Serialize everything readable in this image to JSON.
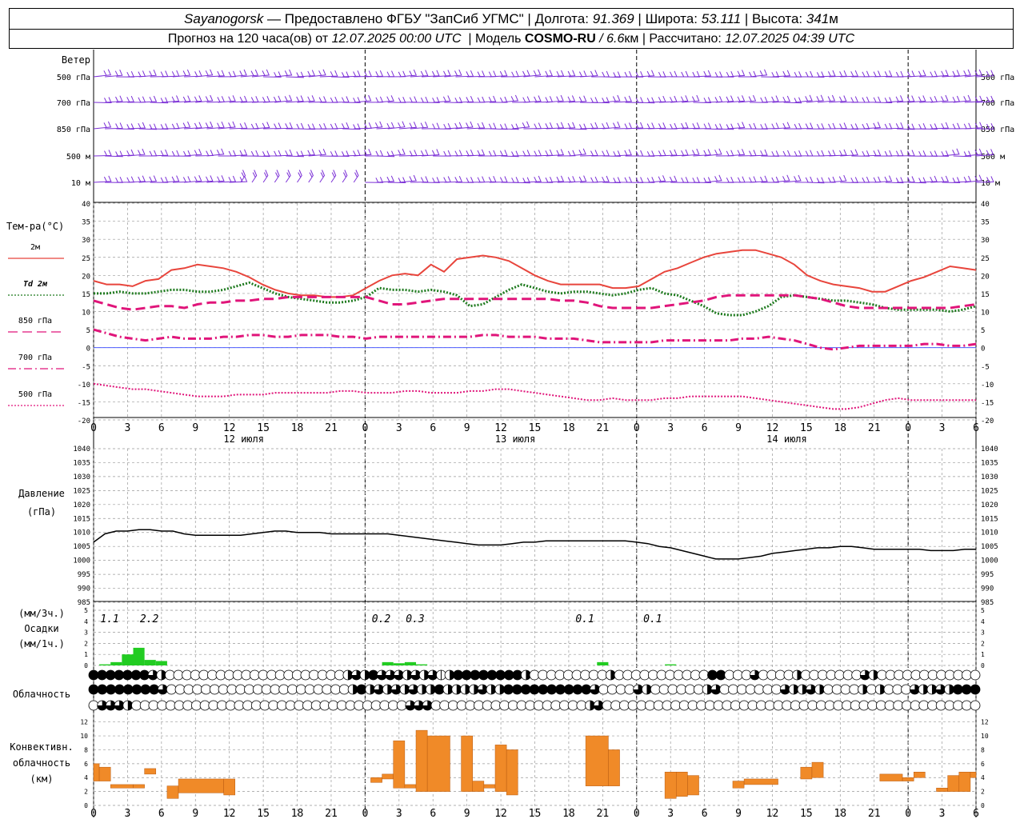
{
  "header": {
    "station": "Sayanogorsk",
    "provided_by": "— Предоставлено ФГБУ \"ЗапСиб УГМС\"",
    "lon_label": "Долгота:",
    "lon_value": "91.369",
    "lat_label": "Широта:",
    "lat_value": "53.111",
    "alt_label": "Высота:",
    "alt_value": "341",
    "alt_unit": "м",
    "forecast_prefix": "Прогноз на 120 часа(ов) от",
    "forecast_start": "12.07.2025 00:00 UTC",
    "model_label": "Модель",
    "model_name": "COSMO-RU",
    "model_res": "/ 6.6",
    "model_res_unit": "км",
    "calc_label": "Рассчитано:",
    "calc_time": "12.07.2025 04:39 UTC"
  },
  "chart_data": [
    {
      "type": "barbs",
      "title": "Ветер",
      "levels": [
        "500 гПа",
        "700 гПа",
        "850 гПа",
        "500 м",
        "10 м"
      ],
      "right_levels": [
        "500 гПа",
        "700 гПа",
        "850 гПа",
        "500 м",
        "10 м"
      ],
      "color": "#7b2fd6"
    },
    {
      "type": "line",
      "title": "Тем-ра(°С)",
      "ylim": [
        -20,
        40
      ],
      "yticks": [
        -20,
        -15,
        -10,
        -5,
        0,
        5,
        10,
        15,
        20,
        25,
        30,
        35,
        40
      ],
      "x_ticks": [
        "0",
        "3",
        "6",
        "9",
        "12",
        "15",
        "18",
        "21",
        "0",
        "3",
        "6",
        "9",
        "12",
        "15",
        "18",
        "21",
        "0",
        "3",
        "6",
        "9",
        "12",
        "15",
        "18",
        "21",
        "0",
        "3",
        "6"
      ],
      "day_labels": [
        "12 июля",
        "13 июля",
        "14 июля"
      ],
      "series": [
        {
          "name": "2м",
          "color": "#e8453c",
          "style": "solid",
          "values": [
            18.5,
            17.5,
            17.5,
            17.0,
            18.5,
            19.0,
            21.5,
            22.0,
            23.0,
            22.5,
            22.0,
            21.0,
            19.5,
            17.5,
            16.0,
            15.0,
            14.5,
            14.5,
            14.0,
            14.0,
            14.5,
            16.5,
            18.5,
            20.0,
            20.5,
            20.0,
            23.0,
            21.0,
            24.5,
            25.0,
            25.5,
            25.0,
            24.0,
            22.0,
            20.0,
            18.5,
            17.5,
            17.5,
            17.5,
            17.5,
            16.5,
            16.5,
            17.0,
            19.0,
            21.0,
            22.0,
            23.5,
            25.0,
            26.0,
            26.5,
            27.0,
            27.0,
            26.0,
            25.0,
            23.0,
            20.0,
            18.5,
            17.5,
            17.0,
            16.5,
            15.5,
            15.5,
            17.0,
            18.5,
            19.5,
            21.0,
            22.5,
            22.0,
            21.5
          ]
        },
        {
          "name": "Td 2м",
          "color": "#1e7a1e",
          "style": "dotted",
          "values": [
            15.0,
            15.0,
            15.5,
            15.0,
            15.0,
            15.5,
            16.0,
            16.0,
            15.5,
            15.5,
            16.0,
            17.0,
            18.0,
            16.5,
            15.0,
            14.0,
            13.5,
            13.0,
            12.5,
            12.5,
            13.0,
            14.0,
            16.5,
            16.0,
            16.0,
            15.5,
            16.0,
            15.5,
            14.5,
            11.5,
            12.0,
            14.0,
            16.0,
            17.5,
            16.5,
            15.5,
            15.0,
            15.5,
            15.5,
            15.0,
            14.5,
            15.0,
            16.0,
            16.5,
            15.0,
            14.5,
            13.0,
            11.5,
            9.5,
            9.0,
            9.0,
            10.0,
            11.5,
            14.0,
            14.5,
            14.0,
            13.5,
            13.0,
            13.0,
            12.5,
            12.0,
            11.0,
            10.5,
            10.5,
            10.5,
            10.5,
            10.0,
            10.5,
            11.5
          ]
        },
        {
          "name": "850 гПа",
          "color": "#e0157a",
          "style": "dashed",
          "values": [
            13.0,
            12.0,
            11.0,
            10.5,
            11.0,
            11.5,
            11.5,
            11.0,
            12.0,
            12.5,
            12.5,
            13.0,
            13.0,
            13.5,
            13.5,
            14.0,
            14.0,
            14.0,
            14.0,
            14.0,
            14.0,
            14.0,
            13.0,
            12.0,
            12.0,
            12.5,
            13.0,
            13.5,
            13.5,
            13.5,
            13.5,
            13.5,
            13.5,
            13.5,
            13.5,
            13.5,
            13.0,
            13.0,
            12.5,
            11.5,
            11.0,
            11.0,
            11.0,
            11.0,
            11.5,
            12.0,
            12.5,
            13.0,
            14.0,
            14.5,
            14.5,
            14.5,
            14.5,
            14.5,
            14.5,
            14.0,
            13.5,
            12.5,
            11.5,
            11.0,
            11.0,
            11.0,
            11.0,
            11.0,
            11.0,
            11.0,
            11.0,
            11.5,
            12.0
          ]
        },
        {
          "name": "700 гПа",
          "color": "#e0157a",
          "style": "dashdot",
          "values": [
            5.0,
            4.0,
            3.0,
            2.5,
            2.0,
            2.5,
            3.0,
            2.5,
            2.5,
            2.5,
            3.0,
            3.0,
            3.5,
            3.5,
            3.0,
            3.0,
            3.5,
            3.5,
            3.5,
            3.0,
            3.0,
            2.5,
            3.0,
            3.0,
            3.0,
            3.0,
            3.0,
            3.0,
            3.0,
            3.0,
            3.5,
            3.5,
            3.0,
            3.0,
            3.0,
            2.5,
            2.5,
            2.5,
            2.0,
            1.5,
            1.5,
            1.5,
            1.5,
            1.5,
            2.0,
            2.0,
            2.0,
            2.0,
            2.0,
            2.0,
            2.5,
            2.5,
            3.0,
            2.5,
            2.0,
            1.0,
            0.0,
            -0.5,
            0.0,
            0.5,
            0.5,
            0.5,
            0.5,
            0.5,
            1.0,
            1.0,
            0.5,
            0.5,
            1.0
          ]
        },
        {
          "name": "500 гПа",
          "color": "#e0157a",
          "style": "dense-dotted",
          "values": [
            -10.0,
            -10.5,
            -11.0,
            -11.5,
            -11.5,
            -12.0,
            -12.5,
            -13.0,
            -13.5,
            -13.5,
            -13.5,
            -13.0,
            -13.0,
            -13.0,
            -12.5,
            -12.5,
            -12.5,
            -12.5,
            -12.5,
            -12.0,
            -12.0,
            -12.5,
            -12.5,
            -12.5,
            -12.0,
            -12.0,
            -12.5,
            -12.5,
            -12.5,
            -12.0,
            -12.0,
            -11.5,
            -11.5,
            -12.0,
            -12.5,
            -13.0,
            -13.5,
            -14.0,
            -14.5,
            -14.5,
            -14.0,
            -14.5,
            -14.5,
            -14.5,
            -14.0,
            -14.0,
            -13.5,
            -13.5,
            -13.5,
            -13.5,
            -13.5,
            -14.0,
            -14.5,
            -15.0,
            -15.5,
            -16.0,
            -16.5,
            -17.0,
            -17.0,
            -16.5,
            -15.5,
            -14.5,
            -14.0,
            -14.5,
            -14.5,
            -14.5,
            -14.5,
            -14.5,
            -14.5
          ]
        }
      ]
    },
    {
      "type": "line",
      "title": "Давление",
      "title_unit": "(гПа)",
      "ylim": [
        985,
        1040
      ],
      "yticks": [
        985,
        990,
        995,
        1000,
        1005,
        1010,
        1015,
        1020,
        1025,
        1030,
        1035,
        1040
      ],
      "series": [
        {
          "color": "#000000",
          "values": [
            1006.5,
            1009.5,
            1010.5,
            1010.5,
            1011.0,
            1011.0,
            1010.5,
            1010.5,
            1009.5,
            1009.0,
            1009.0,
            1009.0,
            1009.0,
            1009.0,
            1009.5,
            1010.0,
            1010.5,
            1010.5,
            1010.0,
            1010.0,
            1010.0,
            1009.5,
            1009.5,
            1009.5,
            1009.5,
            1009.5,
            1009.5,
            1009.0,
            1008.5,
            1008.0,
            1007.5,
            1007.0,
            1006.5,
            1006.0,
            1005.5,
            1005.5,
            1005.5,
            1006.0,
            1006.5,
            1006.5,
            1007.0,
            1007.0,
            1007.0,
            1007.0,
            1007.0,
            1007.0,
            1007.0,
            1007.0,
            1006.5,
            1006.0,
            1005.0,
            1004.5,
            1003.5,
            1002.5,
            1001.5,
            1000.5,
            1000.5,
            1000.5,
            1001.0,
            1001.5,
            1002.5,
            1003.0,
            1003.5,
            1004.0,
            1004.5,
            1004.5,
            1005.0,
            1005.0,
            1004.5,
            1004.0,
            1004.0,
            1004.0,
            1004.0,
            1004.0,
            1003.5,
            1003.5,
            1003.5,
            1004.0,
            1004.0
          ]
        }
      ]
    },
    {
      "type": "bar",
      "title": "Осадки",
      "unit_top": "(мм/3ч.)",
      "unit_bottom": "(мм/1ч.)",
      "ylim": [
        0,
        5
      ],
      "yticks": [
        0,
        1,
        2,
        3,
        4,
        5
      ],
      "color": "#22cc22",
      "totals": [
        {
          "hour": 1,
          "label": "1.1"
        },
        {
          "hour": 4.5,
          "label": "2.2"
        },
        {
          "hour": 25,
          "label": "0.2"
        },
        {
          "hour": 28,
          "label": "0.3"
        },
        {
          "hour": 43,
          "label": "0.1"
        },
        {
          "hour": 49,
          "label": "0.1"
        }
      ],
      "hours": [
        1,
        2,
        3,
        4,
        5,
        6,
        26,
        27,
        28,
        29,
        45,
        51
      ],
      "values": [
        0.1,
        0.3,
        1.0,
        1.6,
        0.5,
        0.4,
        0.3,
        0.2,
        0.3,
        0.1,
        0.3,
        0.1
      ]
    },
    {
      "type": "cloud-cover",
      "title": "Облачность",
      "rows": [
        "11111113Z000000000000000000000Z3Z1333Z3Z3VZ11111111Z000000000Z000000000001100030000Z00000003Z000000000000",
        "111111113000000000000000000000Z1Z3Z3Z3ZZ1ZZZZ3ZZ1111111111300003Z000000Z300000003ZZ3Z0000Z0Z0003ZZ3Z111",
        "0333Z00000000000000000000000000000000333000000000000000000Z300000000000000000000000000000000000000000000"
      ]
    },
    {
      "type": "bar",
      "title": "Конвективн. облачность",
      "unit": "(км)",
      "ylim": [
        0,
        13
      ],
      "yticks": [
        0,
        2,
        4,
        6,
        8,
        10,
        12
      ],
      "color": "#f08a28",
      "bars": [
        {
          "h0": 0,
          "h1": 0.5,
          "base": 3.5,
          "top": 6.0
        },
        {
          "h0": 0.5,
          "h1": 1.5,
          "base": 3.5,
          "top": 5.5
        },
        {
          "h0": 1.5,
          "h1": 3.5,
          "base": 2.5,
          "top": 3.0
        },
        {
          "h0": 3.5,
          "h1": 4.5,
          "base": 2.5,
          "top": 3.0
        },
        {
          "h0": 4.5,
          "h1": 5.5,
          "base": 4.5,
          "top": 5.3
        },
        {
          "h0": 6.5,
          "h1": 7.5,
          "base": 1.0,
          "top": 2.8
        },
        {
          "h0": 7.5,
          "h1": 11.5,
          "base": 1.8,
          "top": 3.8
        },
        {
          "h0": 11.5,
          "h1": 12.5,
          "base": 1.5,
          "top": 3.8
        },
        {
          "h0": 24.5,
          "h1": 25.5,
          "base": 3.3,
          "top": 4.0
        },
        {
          "h0": 25.5,
          "h1": 26.5,
          "base": 3.8,
          "top": 4.5
        },
        {
          "h0": 26.5,
          "h1": 27.5,
          "base": 2.5,
          "top": 9.3
        },
        {
          "h0": 27.5,
          "h1": 28.5,
          "base": 2.5,
          "top": 3.0
        },
        {
          "h0": 28.5,
          "h1": 29.5,
          "base": 2.0,
          "top": 10.8
        },
        {
          "h0": 29.5,
          "h1": 31.5,
          "base": 2.0,
          "top": 10.0
        },
        {
          "h0": 32.5,
          "h1": 33.5,
          "base": 2.0,
          "top": 10.0
        },
        {
          "h0": 33.5,
          "h1": 34.5,
          "base": 2.0,
          "top": 3.5
        },
        {
          "h0": 34.5,
          "h1": 35.5,
          "base": 2.5,
          "top": 3.0
        },
        {
          "h0": 35.5,
          "h1": 36.5,
          "base": 2.0,
          "top": 8.7
        },
        {
          "h0": 36.5,
          "h1": 37.5,
          "base": 1.5,
          "top": 8.0
        },
        {
          "h0": 43.5,
          "h1": 45.5,
          "base": 2.8,
          "top": 10.0
        },
        {
          "h0": 45.5,
          "h1": 46.5,
          "base": 2.8,
          "top": 8.0
        },
        {
          "h0": 50.5,
          "h1": 51.5,
          "base": 1.0,
          "top": 4.8
        },
        {
          "h0": 51.5,
          "h1": 52.5,
          "base": 1.3,
          "top": 4.8
        },
        {
          "h0": 52.5,
          "h1": 53.5,
          "base": 1.5,
          "top": 4.3
        },
        {
          "h0": 56.5,
          "h1": 57.5,
          "base": 2.5,
          "top": 3.5
        },
        {
          "h0": 57.5,
          "h1": 60.5,
          "base": 3.0,
          "top": 3.8
        },
        {
          "h0": 62.5,
          "h1": 63.5,
          "base": 3.8,
          "top": 5.5
        },
        {
          "h0": 63.5,
          "h1": 64.5,
          "base": 4.0,
          "top": 6.2
        },
        {
          "h0": 69.5,
          "h1": 71.5,
          "base": 3.5,
          "top": 4.5
        },
        {
          "h0": 71.5,
          "h1": 72.5,
          "base": 3.5,
          "top": 4.0
        },
        {
          "h0": 72.5,
          "h1": 73.5,
          "base": 4.0,
          "top": 4.8
        },
        {
          "h0": 74.5,
          "h1": 75.5,
          "base": 2.0,
          "top": 2.5
        },
        {
          "h0": 75.5,
          "h1": 76.5,
          "base": 2.0,
          "top": 4.3
        },
        {
          "h0": 76.5,
          "h1": 77.5,
          "base": 2.0,
          "top": 4.8
        },
        {
          "h0": 77.5,
          "h1": 78.5,
          "base": 4.0,
          "top": 4.8
        }
      ]
    }
  ]
}
